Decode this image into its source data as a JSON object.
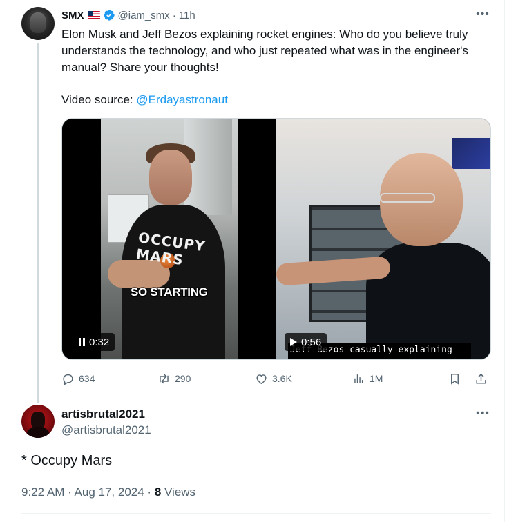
{
  "tweet": {
    "author_name": "SMX",
    "author_handle": "@iam_smx",
    "separator": "·",
    "time_ago": "11h",
    "text_line": "Elon Musk and Jeff Bezos explaining rocket engines: Who do you believe truly understands the technology, and who just repeated what was in the engineer's manual? Share your thoughts!",
    "source_label": "Video source: ",
    "source_link": "@Erdayastronaut",
    "more_label": "•••",
    "media": {
      "left_video": {
        "shirt_text": "OCCUPY MARS",
        "caption": "SO STARTING",
        "timestamp": "0:32",
        "state": "paused"
      },
      "right_video": {
        "subtitle": "Jeff Bezos casually explaining",
        "timestamp": "0:56",
        "state": "playing"
      }
    },
    "actions": {
      "replies": "634",
      "reposts": "290",
      "likes": "3.6K",
      "views": "1M"
    }
  },
  "reply": {
    "author_name": "artisbrutal2021",
    "author_handle": "@artisbrutal2021",
    "more_label": "•••",
    "text": "* Occupy Mars",
    "time": "9:22 AM",
    "dot": " · ",
    "date": "Aug 17, 2024",
    "views_count": "8",
    "views_label": "Views"
  },
  "colors": {
    "text_primary": "#0f1419",
    "text_secondary": "#536471",
    "link": "#1d9bf0",
    "verified": "#1d9bf0",
    "border": "#eff3f4"
  }
}
